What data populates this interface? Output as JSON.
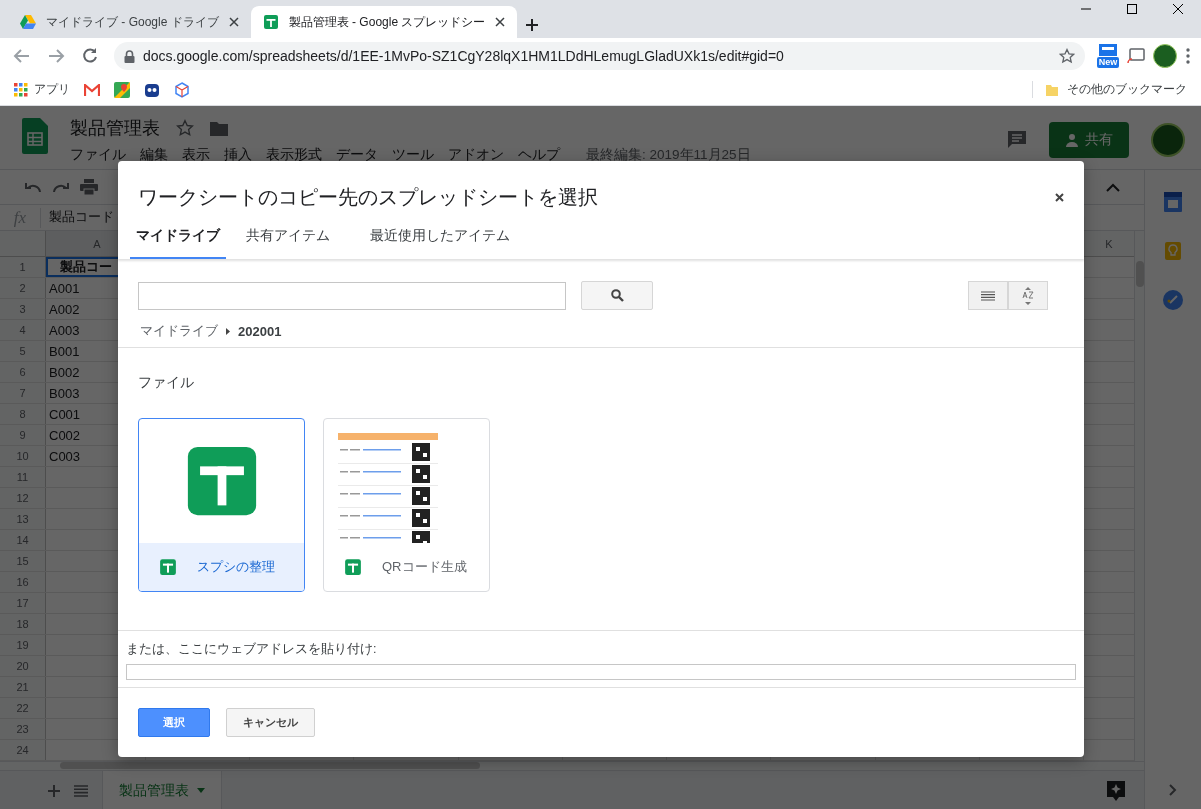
{
  "browser": {
    "tabs": [
      {
        "title": "マイドライブ - Google ドライブ",
        "kind": "drive",
        "selected": false
      },
      {
        "title": "製品管理表 - Google スプレッドシー",
        "kind": "sheets",
        "selected": true
      }
    ],
    "url": "docs.google.com/spreadsheets/d/1EE-1MvPo-SZ1CgY28lqX1HM1LDdHLemugLGladUXk1s/edit#gid=0",
    "extension_badge": "New",
    "apps_label": "アプリ",
    "other_bookmarks": "その他のブックマーク"
  },
  "sheet": {
    "title": "製品管理表",
    "menu": [
      "ファイル",
      "編集",
      "表示",
      "挿入",
      "表示形式",
      "データ",
      "ツール",
      "アドオン",
      "ヘルプ"
    ],
    "last_edit": "最終編集: 2019年11月25日",
    "share": "共有",
    "formula_icon": "fx",
    "formula": "製品コード",
    "first_column": "A",
    "last_column": "K",
    "rows": [
      {
        "number": "1",
        "a": "製品コー",
        "selected": true
      },
      {
        "number": "2",
        "a": "A001",
        "selected": false
      },
      {
        "number": "3",
        "a": "A002",
        "selected": false
      },
      {
        "number": "4",
        "a": "A003",
        "selected": false
      },
      {
        "number": "5",
        "a": "B001",
        "selected": false
      },
      {
        "number": "6",
        "a": "B002",
        "selected": false
      },
      {
        "number": "7",
        "a": "B003",
        "selected": false
      },
      {
        "number": "8",
        "a": "C001",
        "selected": false
      },
      {
        "number": "9",
        "a": "C002",
        "selected": false
      },
      {
        "number": "10",
        "a": "C003",
        "selected": false
      },
      {
        "number": "11",
        "selected": false
      },
      {
        "number": "12",
        "selected": false
      },
      {
        "number": "13",
        "selected": false
      },
      {
        "number": "14",
        "selected": false
      },
      {
        "number": "15",
        "selected": false
      },
      {
        "number": "16",
        "selected": false
      },
      {
        "number": "17",
        "selected": false
      },
      {
        "number": "18",
        "selected": false
      },
      {
        "number": "19",
        "selected": false
      },
      {
        "number": "20",
        "selected": false
      },
      {
        "number": "21",
        "selected": false
      },
      {
        "number": "22",
        "selected": false
      },
      {
        "number": "23",
        "selected": false
      },
      {
        "number": "24",
        "selected": false
      }
    ],
    "sheet_tabs": [
      {
        "label": "製品管理表",
        "selected": true
      }
    ]
  },
  "dialog": {
    "title": "ワークシートのコピー先のスプレッドシートを選択",
    "tabs": [
      {
        "label": "マイドライブ",
        "selected": true
      },
      {
        "label": "共有アイテム",
        "selected": false
      },
      {
        "label": "最近使用したアイテム",
        "selected": false
      }
    ],
    "breadcrumb": [
      "マイドライブ",
      "202001"
    ],
    "section": "ファイル",
    "files": [
      {
        "name": "スプシの整理",
        "kind": "blank",
        "selected": true
      },
      {
        "name": "QRコード生成",
        "kind": "thumbnail",
        "selected": false
      }
    ],
    "url_label": "または、ここにウェブアドレスを貼り付け:",
    "buttons": [
      {
        "label": "選択",
        "kind": "primary"
      },
      {
        "label": "キャンセル",
        "kind": "secondary"
      }
    ]
  }
}
